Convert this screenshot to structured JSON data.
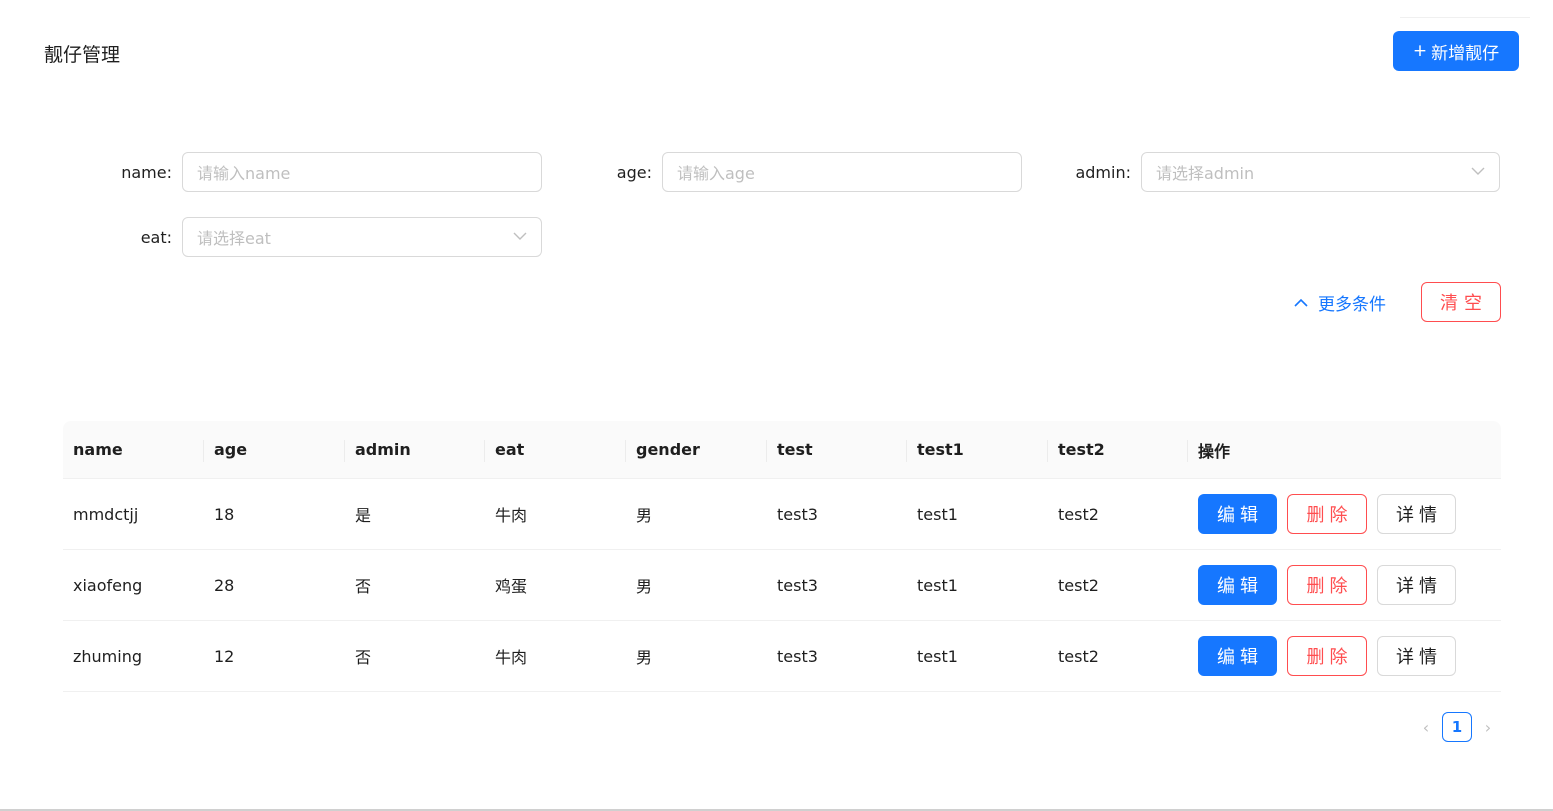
{
  "header": {
    "title": "靓仔管理",
    "add_button_plus": "+",
    "add_button_label": "新增靓仔"
  },
  "filters": {
    "name": {
      "label": "name:",
      "placeholder": "请输入name"
    },
    "age": {
      "label": "age:",
      "placeholder": "请输入age"
    },
    "admin": {
      "label": "admin:",
      "placeholder": "请选择admin"
    },
    "eat": {
      "label": "eat:",
      "placeholder": "请选择eat"
    },
    "more_label": "更多条件",
    "clear_label": "清空"
  },
  "table": {
    "columns": [
      "name",
      "age",
      "admin",
      "eat",
      "gender",
      "test",
      "test1",
      "test2",
      "操作"
    ],
    "rows": [
      [
        "mmdctjj",
        "18",
        "是",
        "牛肉",
        "男",
        "test3",
        "test1",
        "test2"
      ],
      [
        "xiaofeng",
        "28",
        "否",
        "鸡蛋",
        "男",
        "test3",
        "test1",
        "test2"
      ],
      [
        "zhuming",
        "12",
        "否",
        "牛肉",
        "男",
        "test3",
        "test1",
        "test2"
      ]
    ],
    "actions": {
      "edit": "编辑",
      "delete": "删除",
      "detail": "详情"
    }
  },
  "pagination": {
    "current": "1",
    "prev": "‹",
    "next": "›"
  },
  "colors": {
    "primary": "#1677ff",
    "danger": "#ff4d4f"
  }
}
